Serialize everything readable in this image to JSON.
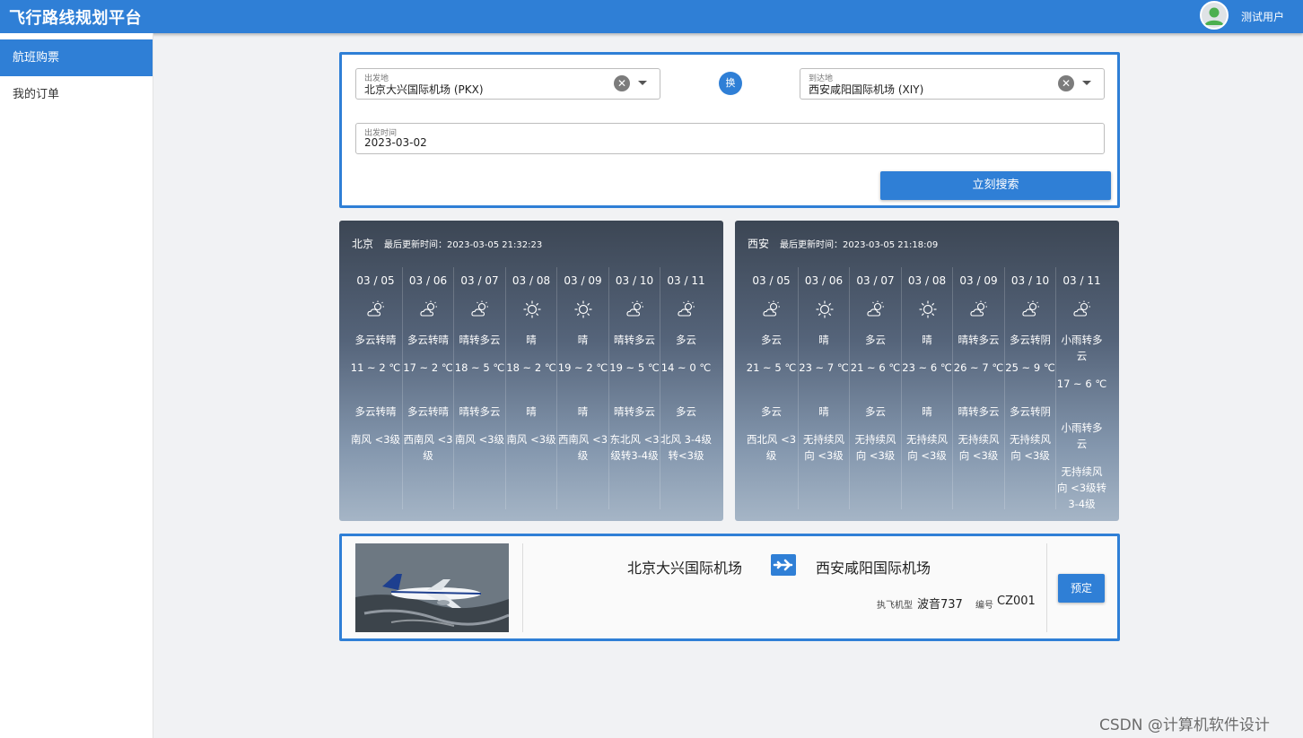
{
  "app": {
    "title": "飞行路线规划平台",
    "user_name": "测试用户"
  },
  "sidebar": {
    "items": [
      {
        "label": "航班购票"
      },
      {
        "label": "我的订单"
      }
    ]
  },
  "search": {
    "from": {
      "label": "出发地",
      "value": "北京大兴国际机场 (PKX)"
    },
    "to": {
      "label": "到达地",
      "value": "西安咸阳国际机场 (XIY)"
    },
    "date": {
      "label": "出发时间",
      "value": "2023-03-02"
    },
    "swap_label": "换",
    "button_label": "立刻搜索"
  },
  "weather": [
    {
      "city": "北京",
      "update": "最后更新时间：2023-03-05 21:32:23",
      "days": [
        {
          "date": "03 / 05",
          "icon": "partly-cloudy-icon",
          "day_text": "多云转晴",
          "temp": "11 ~ 2 ℃",
          "night_text": "多云转晴",
          "wind": "南风 <3级"
        },
        {
          "date": "03 / 06",
          "icon": "partly-cloudy-icon",
          "day_text": "多云转晴",
          "temp": "17 ~ 2 ℃",
          "night_text": "多云转晴",
          "wind": "西南风 <3级"
        },
        {
          "date": "03 / 07",
          "icon": "partly-cloudy-icon",
          "day_text": "晴转多云",
          "temp": "18 ~ 5 ℃",
          "night_text": "晴转多云",
          "wind": "南风 <3级"
        },
        {
          "date": "03 / 08",
          "icon": "sun-icon",
          "day_text": "晴",
          "temp": "18 ~ 2 ℃",
          "night_text": "晴",
          "wind": "南风 <3级"
        },
        {
          "date": "03 / 09",
          "icon": "sun-icon",
          "day_text": "晴",
          "temp": "19 ~ 2 ℃",
          "night_text": "晴",
          "wind": "西南风 <3级"
        },
        {
          "date": "03 / 10",
          "icon": "partly-cloudy-icon",
          "day_text": "晴转多云",
          "temp": "19 ~ 5 ℃",
          "night_text": "晴转多云",
          "wind": "东北风 <3级转3-4级"
        },
        {
          "date": "03 / 11",
          "icon": "partly-cloudy-icon",
          "day_text": "多云",
          "temp": "14 ~ 0 ℃",
          "night_text": "多云",
          "wind": "北风 3-4级转<3级"
        }
      ]
    },
    {
      "city": "西安",
      "update": "最后更新时间：2023-03-05 21:18:09",
      "days": [
        {
          "date": "03 / 05",
          "icon": "partly-cloudy-icon",
          "day_text": "多云",
          "temp": "21 ~ 5 ℃",
          "night_text": "多云",
          "wind": "西北风 <3级"
        },
        {
          "date": "03 / 06",
          "icon": "sun-icon",
          "day_text": "晴",
          "temp": "23 ~ 7 ℃",
          "night_text": "晴",
          "wind": "无持续风向 <3级"
        },
        {
          "date": "03 / 07",
          "icon": "partly-cloudy-icon",
          "day_text": "多云",
          "temp": "21 ~ 6 ℃",
          "night_text": "多云",
          "wind": "无持续风向 <3级"
        },
        {
          "date": "03 / 08",
          "icon": "sun-icon",
          "day_text": "晴",
          "temp": "23 ~ 6 ℃",
          "night_text": "晴",
          "wind": "无持续风向 <3级"
        },
        {
          "date": "03 / 09",
          "icon": "partly-cloudy-icon",
          "day_text": "晴转多云",
          "temp": "26 ~ 7 ℃",
          "night_text": "晴转多云",
          "wind": "无持续风向 <3级"
        },
        {
          "date": "03 / 10",
          "icon": "partly-cloudy-icon",
          "day_text": "多云转阴",
          "temp": "25 ~ 9 ℃",
          "night_text": "多云转阴",
          "wind": "无持续风向 <3级"
        },
        {
          "date": "03 / 11",
          "icon": "partly-cloudy-icon",
          "day_text": "小雨转多云",
          "temp": "17 ~ 6 ℃",
          "night_text": "小雨转多云",
          "wind": "无持续风向 <3级转3-4级"
        }
      ]
    }
  ],
  "flight": {
    "from": "北京大兴国际机场",
    "to": "西安咸阳国际机场",
    "aircraft_label": "执飞机型",
    "aircraft_value": "波音737",
    "number_label": "编号",
    "number_value": "CZ001",
    "book_label": "预定"
  },
  "watermark": "CSDN @计算机软件设计",
  "colors": {
    "primary": "#2f7fd6"
  }
}
